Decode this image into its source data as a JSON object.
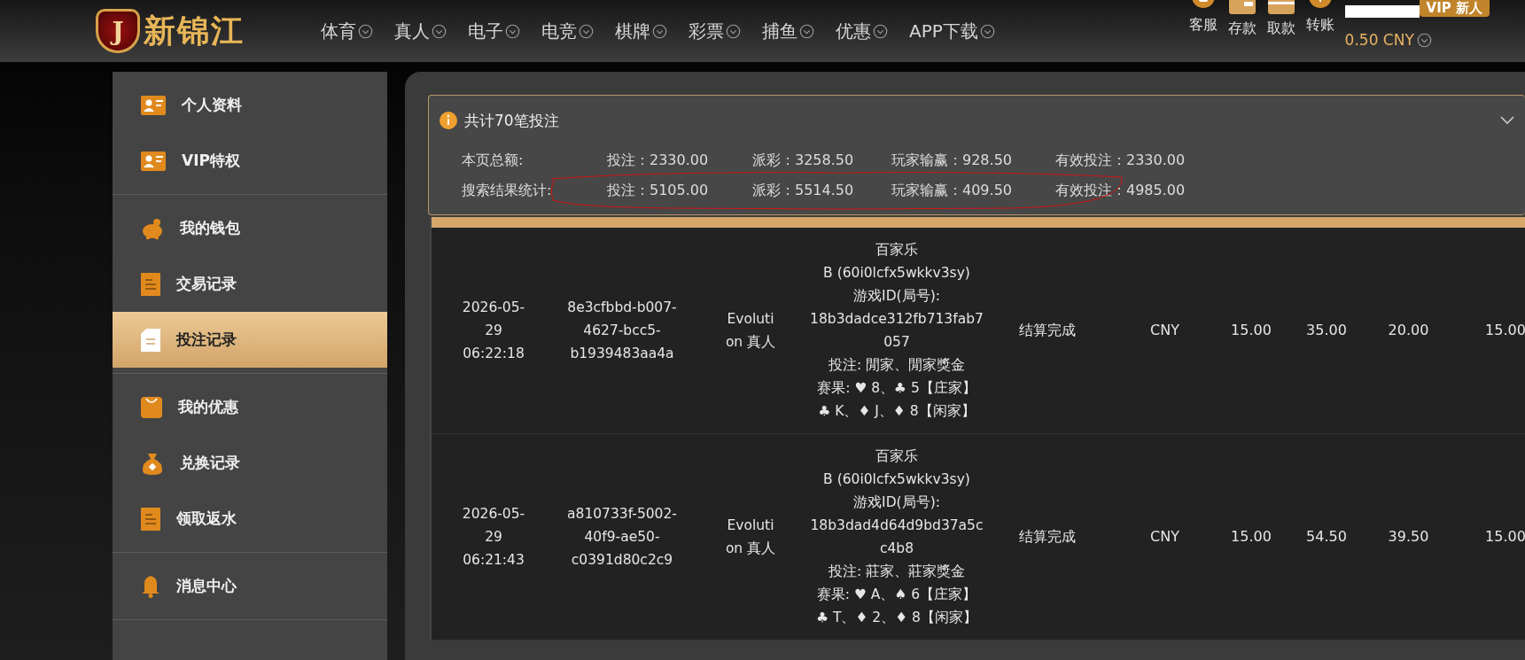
{
  "logo": {
    "mark": "J",
    "name": "新锦江"
  },
  "nav": [
    {
      "label": "体育"
    },
    {
      "label": "真人"
    },
    {
      "label": "电子"
    },
    {
      "label": "电竞"
    },
    {
      "label": "棋牌"
    },
    {
      "label": "彩票"
    },
    {
      "label": "捕鱼"
    },
    {
      "label": "优惠"
    },
    {
      "label": "APP下载"
    }
  ],
  "account_actions": [
    {
      "label": "客服"
    },
    {
      "label": "存款"
    },
    {
      "label": "取款"
    },
    {
      "label": "转账"
    }
  ],
  "balance": "0.50 CNY",
  "vip_badge": "VIP 新人",
  "sidebar": {
    "groups": [
      {
        "items": [
          {
            "label": "个人资料",
            "selected": false
          },
          {
            "label": "VIP特权",
            "selected": false
          }
        ]
      },
      {
        "items": [
          {
            "label": "我的钱包",
            "selected": false
          },
          {
            "label": "交易记录",
            "selected": false
          },
          {
            "label": "投注记录",
            "selected": true
          }
        ]
      },
      {
        "items": [
          {
            "label": "我的优惠",
            "selected": false
          },
          {
            "label": "兑换记录",
            "selected": false
          },
          {
            "label": "领取返水",
            "selected": false
          }
        ]
      },
      {
        "items": [
          {
            "label": "消息中心",
            "selected": false
          }
        ]
      }
    ]
  },
  "summary": {
    "title": "共计70笔投注",
    "expanded": true,
    "rows": [
      {
        "label": "本页总额:",
        "stats": [
          "投注：2330.00",
          "派彩：3258.50",
          "玩家输赢：928.50",
          "有效投注：2330.00"
        ]
      },
      {
        "label": "搜索结果统计:",
        "stats": [
          "投注：5105.00",
          "派彩：5514.50",
          "玩家输赢：409.50",
          "有效投注：4985.00"
        ],
        "circled": true
      }
    ]
  },
  "table": {
    "rows": [
      {
        "time": [
          "2026-05-",
          "29",
          "06:22:18"
        ],
        "order_id": [
          "8e3cfbbd-b007-",
          "4627-bcc5-",
          "b1939483aa4a"
        ],
        "provider": [
          "Evoluti",
          "on 真人"
        ],
        "detail": [
          "百家乐",
          "B (60i0lcfx5wkkv3sy)",
          "游戏ID(局号):",
          "18b3dadce312fb713fab7",
          "057",
          "投注: 閒家、閒家獎金",
          "赛果: ♥ 8、♣ 5【庄家】",
          "♣ K、♦ J、♦ 8【闲家】"
        ],
        "status": "结算完成",
        "currency": "CNY",
        "bet": "15.00",
        "payout": "35.00",
        "win_loss": "20.00",
        "valid_bet": "15.00"
      },
      {
        "time": [
          "2026-05-",
          "29",
          "06:21:43"
        ],
        "order_id": [
          "a810733f-5002-",
          "40f9-ae50-",
          "c0391d80c2c9"
        ],
        "provider": [
          "Evoluti",
          "on 真人"
        ],
        "detail": [
          "百家乐",
          "B (60i0lcfx5wkkv3sy)",
          "游戏ID(局号):",
          "18b3dad4d64d9bd37a5c",
          "c4b8",
          "投注: 莊家、莊家獎金",
          "赛果: ♥ A、♠ 6【庄家】",
          "♣ T、♦ 2、♦ 8【闲家】"
        ],
        "status": "结算完成",
        "currency": "CNY",
        "bet": "15.00",
        "payout": "54.50",
        "win_loss": "39.50",
        "valid_bet": "15.00"
      }
    ]
  }
}
